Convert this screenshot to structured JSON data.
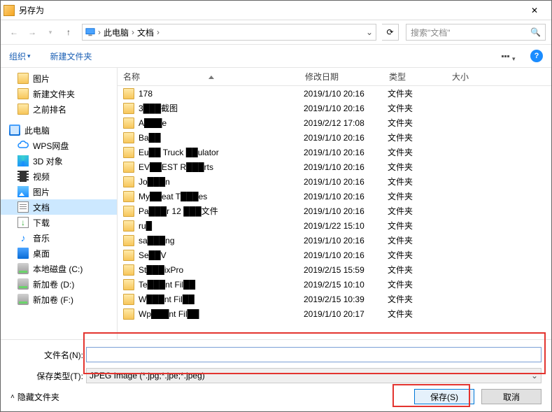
{
  "title": "另存为",
  "nav": {
    "path_root": "此电脑",
    "path_current": "文档",
    "search_placeholder": "搜索\"文档\""
  },
  "toolbar": {
    "organize": "组织",
    "newfolder": "新建文件夹"
  },
  "columns": {
    "name": "名称",
    "date": "修改日期",
    "type": "类型",
    "size": "大小"
  },
  "sidebar": [
    {
      "icon": "folder",
      "label": "图片"
    },
    {
      "icon": "folder",
      "label": "新建文件夹"
    },
    {
      "icon": "folder",
      "label": "之前排名"
    },
    {
      "icon": "pc",
      "label": "此电脑",
      "lvl": 1,
      "spaced": true
    },
    {
      "icon": "cloud",
      "label": "WPS网盘"
    },
    {
      "icon": "3d",
      "label": "3D 对象"
    },
    {
      "icon": "film",
      "label": "视频"
    },
    {
      "icon": "img",
      "label": "图片"
    },
    {
      "icon": "doc",
      "label": "文档",
      "selected": true
    },
    {
      "icon": "dl",
      "label": "下载"
    },
    {
      "icon": "music",
      "label": "音乐"
    },
    {
      "icon": "desk",
      "label": "桌面"
    },
    {
      "icon": "disk",
      "label": "本地磁盘 (C:)"
    },
    {
      "icon": "disk",
      "label": "新加卷 (D:)"
    },
    {
      "icon": "disk",
      "label": "新加卷 (F:)"
    }
  ],
  "files": [
    {
      "name": "178",
      "date": "2019/1/10 20:16",
      "type": "文件夹"
    },
    {
      "name": "3███截图",
      "date": "2019/1/10 20:16",
      "type": "文件夹"
    },
    {
      "name": "A███e",
      "date": "2019/2/12 17:08",
      "type": "文件夹"
    },
    {
      "name": "Ba██",
      "date": "2019/1/10 20:16",
      "type": "文件夹"
    },
    {
      "name": "Eu██ Truck ██ulator",
      "date": "2019/1/10 20:16",
      "type": "文件夹"
    },
    {
      "name": "EV██EST R███rts",
      "date": "2019/1/10 20:16",
      "type": "文件夹"
    },
    {
      "name": "Jo███n",
      "date": "2019/1/10 20:16",
      "type": "文件夹"
    },
    {
      "name": "My██eat T███es",
      "date": "2019/1/10 20:16",
      "type": "文件夹"
    },
    {
      "name": "Pa███r 12 ███文件",
      "date": "2019/1/10 20:16",
      "type": "文件夹"
    },
    {
      "name": "ru█",
      "date": "2019/1/22 15:10",
      "type": "文件夹"
    },
    {
      "name": "sa███ng",
      "date": "2019/1/10 20:16",
      "type": "文件夹"
    },
    {
      "name": "Se██V",
      "date": "2019/1/10 20:16",
      "type": "文件夹"
    },
    {
      "name": "St███ixPro",
      "date": "2019/2/15 15:59",
      "type": "文件夹"
    },
    {
      "name": "Te███nt Fil██",
      "date": "2019/2/15 10:10",
      "type": "文件夹"
    },
    {
      "name": "W███nt Fil██",
      "date": "2019/2/15 10:39",
      "type": "文件夹"
    },
    {
      "name": "Wp███nt Fil██",
      "date": "2019/1/10 20:17",
      "type": "文件夹"
    }
  ],
  "form": {
    "filename_label": "文件名(N):",
    "filetype_label": "保存类型(T):",
    "filename_value": "",
    "filetype_value": "JPEG Image (*.jpg;*.jpe;*.jpeg)"
  },
  "footer": {
    "hide": "隐藏文件夹",
    "save": "保存(S)",
    "cancel": "取消"
  }
}
